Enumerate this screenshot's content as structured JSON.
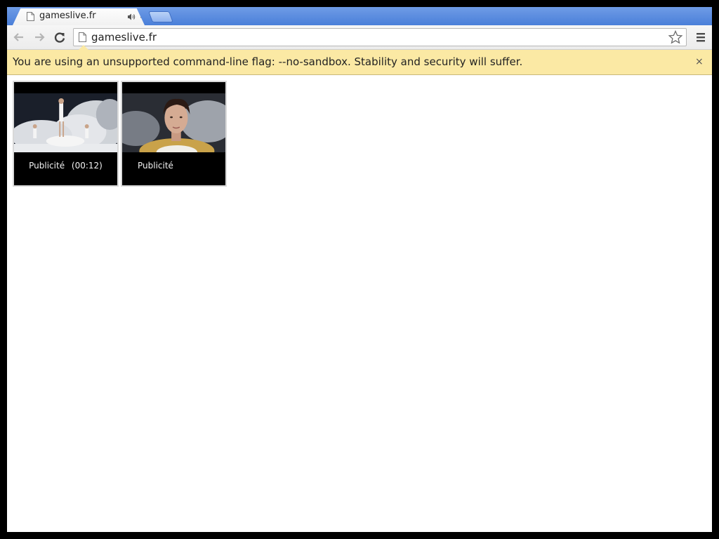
{
  "tab": {
    "title": "gameslive.fr",
    "audio_icon": "speaker-icon",
    "close_label": "×"
  },
  "toolbar": {
    "url": "gameslive.fr"
  },
  "infobar": {
    "message": "You are using an unsupported command-line flag: --no-sandbox. Stability and security will suffer.",
    "close_label": "×"
  },
  "ads": [
    {
      "label": "Publicité",
      "duration": "(00:12)"
    },
    {
      "label": "Publicité",
      "duration": ""
    }
  ],
  "colors": {
    "tabstrip": "#4a7fd9",
    "infobar": "#fbe9a4"
  }
}
